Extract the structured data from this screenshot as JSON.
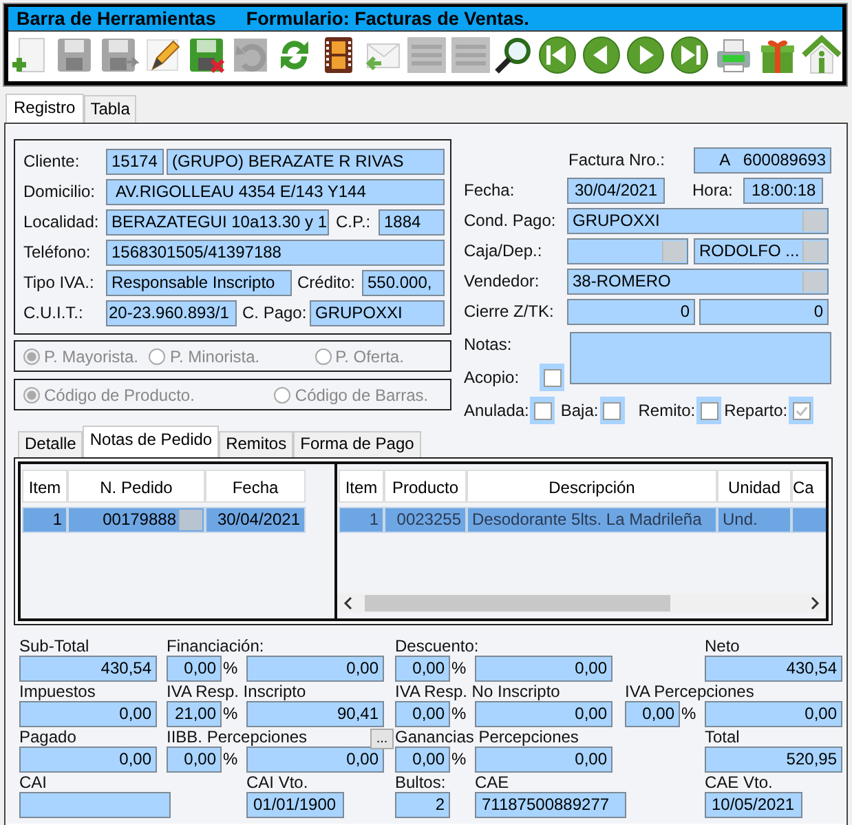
{
  "title_bar": {
    "title": "Barra de Herramientas",
    "form": "Formulario: Facturas de Ventas."
  },
  "toolbar": [
    {
      "kind": "new",
      "disabled": false
    },
    {
      "kind": "save",
      "disabled": true
    },
    {
      "kind": "save-as",
      "disabled": true
    },
    {
      "kind": "edit",
      "disabled": false
    },
    {
      "kind": "cancel",
      "disabled": false
    },
    {
      "kind": "undo",
      "disabled": true
    },
    {
      "kind": "refresh",
      "disabled": false
    },
    {
      "kind": "film",
      "disabled": false
    },
    {
      "kind": "reply",
      "disabled": false
    },
    {
      "kind": "list",
      "disabled": true
    },
    {
      "kind": "list",
      "disabled": true
    },
    {
      "kind": "search",
      "disabled": false
    },
    {
      "kind": "first",
      "disabled": false
    },
    {
      "kind": "prev",
      "disabled": false
    },
    {
      "kind": "next",
      "disabled": false
    },
    {
      "kind": "last",
      "disabled": false
    },
    {
      "kind": "print",
      "disabled": false
    },
    {
      "kind": "gift",
      "disabled": false
    },
    {
      "kind": "home",
      "disabled": false
    }
  ],
  "tabs": [
    {
      "label": "Registro",
      "selected": true
    },
    {
      "label": "Tabla",
      "selected": false
    }
  ],
  "cliente": {
    "label": "Cliente:",
    "codigo": "15174",
    "nombre": "(GRUPO) BERAZATE R RIVAS"
  },
  "domicilio": {
    "label": "Domicilio:",
    "value": "AV.RIGOLLEAU 4354 E/143 Y144"
  },
  "localidad": {
    "label": "Localidad:",
    "value": "BERAZATEGUI 10a13.30 y 1"
  },
  "cp": {
    "label": "C.P.:",
    "value": "1884"
  },
  "telefono": {
    "label": "Teléfono:",
    "value": "1568301505/41397188"
  },
  "tipo_iva": {
    "label": "Tipo IVA.:",
    "value": "Responsable Inscripto"
  },
  "credito": {
    "label": "Crédito:",
    "value": "550.000,"
  },
  "cuit": {
    "label": "C.U.I.T.:",
    "value": "20-23.960.893/1"
  },
  "c_pago": {
    "label": "C. Pago:",
    "value": "GRUPOXXI"
  },
  "factura": {
    "label": "Factura Nro.:",
    "value": "A   600089693"
  },
  "fecha": {
    "label": "Fecha:",
    "value": "30/04/2021"
  },
  "hora": {
    "label": "Hora:",
    "value": "18:00:18"
  },
  "cond_pago": {
    "label": "Cond. Pago:",
    "value": "GRUPOXXI"
  },
  "caja": {
    "label": "Caja/Dep.:",
    "deposito": "RODOLFO ..."
  },
  "vendedor": {
    "label": "Vendedor:",
    "value": "38-ROMERO"
  },
  "cierre": {
    "label": "Cierre Z/TK:",
    "values": [
      "0",
      "0"
    ]
  },
  "notas": {
    "label": "Notas:"
  },
  "acopio": {
    "label": "Acopio:",
    "checked": false
  },
  "flags": [
    {
      "label": "Anulada:",
      "checked": false
    },
    {
      "label": "Baja:",
      "checked": false
    },
    {
      "label": "Remito:",
      "checked": false
    },
    {
      "label": "Reparto:",
      "checked": true
    }
  ],
  "price_options": {
    "disabled": true,
    "options": [
      {
        "label": "P. Mayorista.",
        "selected": true
      },
      {
        "label": "P. Minorista.",
        "selected": false
      },
      {
        "label": "P. Oferta.",
        "selected": false
      }
    ]
  },
  "code_options": {
    "disabled": true,
    "options": [
      {
        "label": "Código de Producto.",
        "selected": true
      },
      {
        "label": "Código de Barras.",
        "selected": false
      }
    ]
  },
  "subtabs": [
    {
      "label": "Detalle",
      "selected": false
    },
    {
      "label": "Notas de Pedido",
      "selected": true
    },
    {
      "label": "Remitos",
      "selected": false
    },
    {
      "label": "Forma de Pago",
      "selected": false
    }
  ],
  "pedidos": {
    "columns": [
      "Item",
      "N. Pedido",
      "Fecha"
    ],
    "rows": [
      {
        "cells": [
          "1",
          "00179888",
          "30/04/2021"
        ],
        "selected": true
      }
    ]
  },
  "productos": {
    "columns": [
      "Item",
      "Producto",
      "Descripción",
      "Unidad",
      "Ca"
    ],
    "rows": [
      {
        "cells": [
          "1",
          "0023255",
          "Desodorante 5lts. La Madrileña",
          "Und."
        ],
        "selected": true
      }
    ]
  },
  "totales": {
    "sub_total": {
      "label": "Sub-Total",
      "value": "430,54"
    },
    "financiacion": {
      "label": "Financiación:",
      "pct": "0,00",
      "unit": "%",
      "amount": "0,00"
    },
    "descuento": {
      "label": "Descuento:",
      "pct": "0,00",
      "unit": "%",
      "amount": "0,00"
    },
    "neto": {
      "label": "Neto",
      "value": "430,54"
    },
    "impuestos": {
      "label": "Impuestos",
      "value": "0,00"
    },
    "iva_inscripto": {
      "label": "IVA Resp. Inscripto",
      "pct": "21,00",
      "unit": "%",
      "amount": "90,41"
    },
    "iva_no_inscripto": {
      "label": "IVA Resp. No Inscripto",
      "pct": "0,00",
      "unit": "%",
      "amount": "0,00"
    },
    "iva_percepciones": {
      "label": "IVA Percepciones",
      "pct": "0,00",
      "unit": "%",
      "amount": "0,00"
    },
    "pagado": {
      "label": "Pagado",
      "value": "0,00"
    },
    "iibb": {
      "label": "IIBB. Percepciones",
      "pct": "0,00",
      "unit": "%",
      "amount": "0,00",
      "button": "..."
    },
    "ganancias": {
      "label": "Ganancias Percepciones",
      "pct": "0,00",
      "unit": "%",
      "amount": "0,00"
    },
    "total": {
      "label": "Total",
      "value": "520,95"
    },
    "cai": {
      "label": "CAI"
    },
    "cai_vto": {
      "label": "CAI Vto.",
      "value": "01/01/1900"
    },
    "bultos": {
      "label": "Bultos:",
      "value": "2"
    },
    "cae": {
      "label": "CAE",
      "value": "71187500889277"
    },
    "cae_vto": {
      "label": "CAE Vto.",
      "value": "10/05/2021"
    }
  }
}
